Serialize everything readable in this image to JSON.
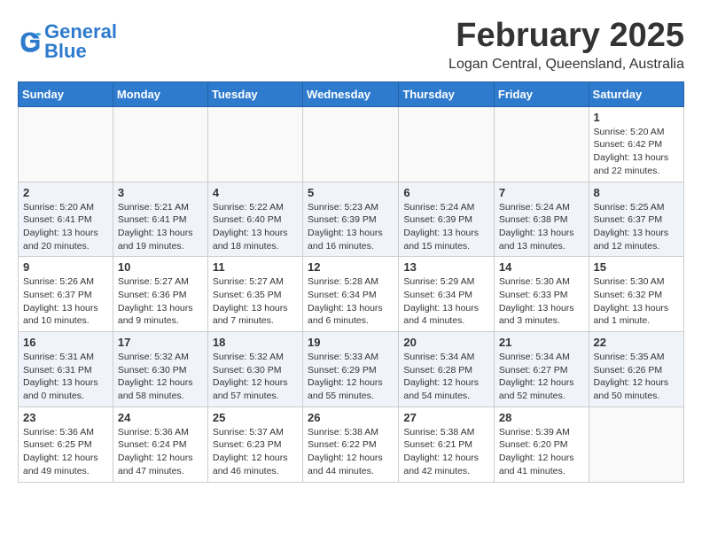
{
  "header": {
    "logo_general": "General",
    "logo_blue": "Blue",
    "month_title": "February 2025",
    "location": "Logan Central, Queensland, Australia"
  },
  "days_of_week": [
    "Sunday",
    "Monday",
    "Tuesday",
    "Wednesday",
    "Thursday",
    "Friday",
    "Saturday"
  ],
  "weeks": [
    {
      "days": [
        {
          "number": "",
          "info": "",
          "empty": true
        },
        {
          "number": "",
          "info": "",
          "empty": true
        },
        {
          "number": "",
          "info": "",
          "empty": true
        },
        {
          "number": "",
          "info": "",
          "empty": true
        },
        {
          "number": "",
          "info": "",
          "empty": true
        },
        {
          "number": "",
          "info": "",
          "empty": true
        },
        {
          "number": "1",
          "info": "Sunrise: 5:20 AM\nSunset: 6:42 PM\nDaylight: 13 hours\nand 22 minutes."
        }
      ]
    },
    {
      "days": [
        {
          "number": "2",
          "info": "Sunrise: 5:20 AM\nSunset: 6:41 PM\nDaylight: 13 hours\nand 20 minutes."
        },
        {
          "number": "3",
          "info": "Sunrise: 5:21 AM\nSunset: 6:41 PM\nDaylight: 13 hours\nand 19 minutes."
        },
        {
          "number": "4",
          "info": "Sunrise: 5:22 AM\nSunset: 6:40 PM\nDaylight: 13 hours\nand 18 minutes."
        },
        {
          "number": "5",
          "info": "Sunrise: 5:23 AM\nSunset: 6:39 PM\nDaylight: 13 hours\nand 16 minutes."
        },
        {
          "number": "6",
          "info": "Sunrise: 5:24 AM\nSunset: 6:39 PM\nDaylight: 13 hours\nand 15 minutes."
        },
        {
          "number": "7",
          "info": "Sunrise: 5:24 AM\nSunset: 6:38 PM\nDaylight: 13 hours\nand 13 minutes."
        },
        {
          "number": "8",
          "info": "Sunrise: 5:25 AM\nSunset: 6:37 PM\nDaylight: 13 hours\nand 12 minutes."
        }
      ]
    },
    {
      "days": [
        {
          "number": "9",
          "info": "Sunrise: 5:26 AM\nSunset: 6:37 PM\nDaylight: 13 hours\nand 10 minutes."
        },
        {
          "number": "10",
          "info": "Sunrise: 5:27 AM\nSunset: 6:36 PM\nDaylight: 13 hours\nand 9 minutes."
        },
        {
          "number": "11",
          "info": "Sunrise: 5:27 AM\nSunset: 6:35 PM\nDaylight: 13 hours\nand 7 minutes."
        },
        {
          "number": "12",
          "info": "Sunrise: 5:28 AM\nSunset: 6:34 PM\nDaylight: 13 hours\nand 6 minutes."
        },
        {
          "number": "13",
          "info": "Sunrise: 5:29 AM\nSunset: 6:34 PM\nDaylight: 13 hours\nand 4 minutes."
        },
        {
          "number": "14",
          "info": "Sunrise: 5:30 AM\nSunset: 6:33 PM\nDaylight: 13 hours\nand 3 minutes."
        },
        {
          "number": "15",
          "info": "Sunrise: 5:30 AM\nSunset: 6:32 PM\nDaylight: 13 hours\nand 1 minute."
        }
      ]
    },
    {
      "days": [
        {
          "number": "16",
          "info": "Sunrise: 5:31 AM\nSunset: 6:31 PM\nDaylight: 13 hours\nand 0 minutes."
        },
        {
          "number": "17",
          "info": "Sunrise: 5:32 AM\nSunset: 6:30 PM\nDaylight: 12 hours\nand 58 minutes."
        },
        {
          "number": "18",
          "info": "Sunrise: 5:32 AM\nSunset: 6:30 PM\nDaylight: 12 hours\nand 57 minutes."
        },
        {
          "number": "19",
          "info": "Sunrise: 5:33 AM\nSunset: 6:29 PM\nDaylight: 12 hours\nand 55 minutes."
        },
        {
          "number": "20",
          "info": "Sunrise: 5:34 AM\nSunset: 6:28 PM\nDaylight: 12 hours\nand 54 minutes."
        },
        {
          "number": "21",
          "info": "Sunrise: 5:34 AM\nSunset: 6:27 PM\nDaylight: 12 hours\nand 52 minutes."
        },
        {
          "number": "22",
          "info": "Sunrise: 5:35 AM\nSunset: 6:26 PM\nDaylight: 12 hours\nand 50 minutes."
        }
      ]
    },
    {
      "days": [
        {
          "number": "23",
          "info": "Sunrise: 5:36 AM\nSunset: 6:25 PM\nDaylight: 12 hours\nand 49 minutes."
        },
        {
          "number": "24",
          "info": "Sunrise: 5:36 AM\nSunset: 6:24 PM\nDaylight: 12 hours\nand 47 minutes."
        },
        {
          "number": "25",
          "info": "Sunrise: 5:37 AM\nSunset: 6:23 PM\nDaylight: 12 hours\nand 46 minutes."
        },
        {
          "number": "26",
          "info": "Sunrise: 5:38 AM\nSunset: 6:22 PM\nDaylight: 12 hours\nand 44 minutes."
        },
        {
          "number": "27",
          "info": "Sunrise: 5:38 AM\nSunset: 6:21 PM\nDaylight: 12 hours\nand 42 minutes."
        },
        {
          "number": "28",
          "info": "Sunrise: 5:39 AM\nSunset: 6:20 PM\nDaylight: 12 hours\nand 41 minutes."
        },
        {
          "number": "",
          "info": "",
          "empty": true
        }
      ]
    }
  ]
}
